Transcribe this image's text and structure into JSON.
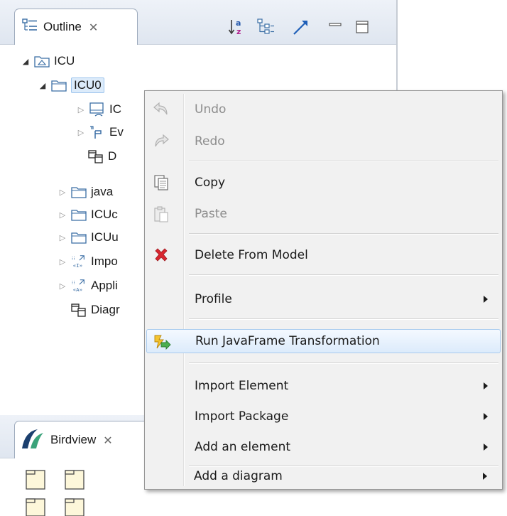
{
  "outline": {
    "tab_title": "Outline",
    "tab_close": "✕",
    "tree": [
      {
        "label": "ICU",
        "twisty": "◢",
        "icon": "package-icon"
      },
      {
        "label": "ICU0",
        "twisty": "◢",
        "icon": "folder-icon",
        "selected": true
      },
      {
        "label": "IC",
        "twisty": "▷",
        "icon": "state-machine-icon"
      },
      {
        "label": "Ev",
        "twisty": "▷",
        "icon": "event-icon"
      },
      {
        "label": "D",
        "twisty": "",
        "icon": "diagram-icon"
      },
      {
        "label": "java",
        "twisty": "▷",
        "icon": "folder-icon"
      },
      {
        "label": "ICUc",
        "twisty": "▷",
        "icon": "folder-icon"
      },
      {
        "label": "ICUu",
        "twisty": "▷",
        "icon": "folder-icon"
      },
      {
        "label": "Impo",
        "twisty": "▷",
        "icon": "import-icon"
      },
      {
        "label": "Appli",
        "twisty": "▷",
        "icon": "apply-icon"
      },
      {
        "label": "Diagr",
        "twisty": "",
        "icon": "diagram-icon"
      }
    ]
  },
  "birdview": {
    "tab_title": "Birdview",
    "tab_close": "✕"
  },
  "menu": {
    "undo": "Undo",
    "redo": "Redo",
    "copy": "Copy",
    "paste": "Paste",
    "delete_from_model": "Delete From Model",
    "profile": "Profile",
    "run_javaframe": "Run JavaFrame Transformation",
    "import_element": "Import Element",
    "import_package": "Import Package",
    "add_element": "Add an element",
    "add_diagram": "Add a diagram"
  },
  "colors": {
    "highlight_border": "#a9cbee",
    "delete_icon": "#d9262f",
    "selection": "#dcebfa"
  }
}
